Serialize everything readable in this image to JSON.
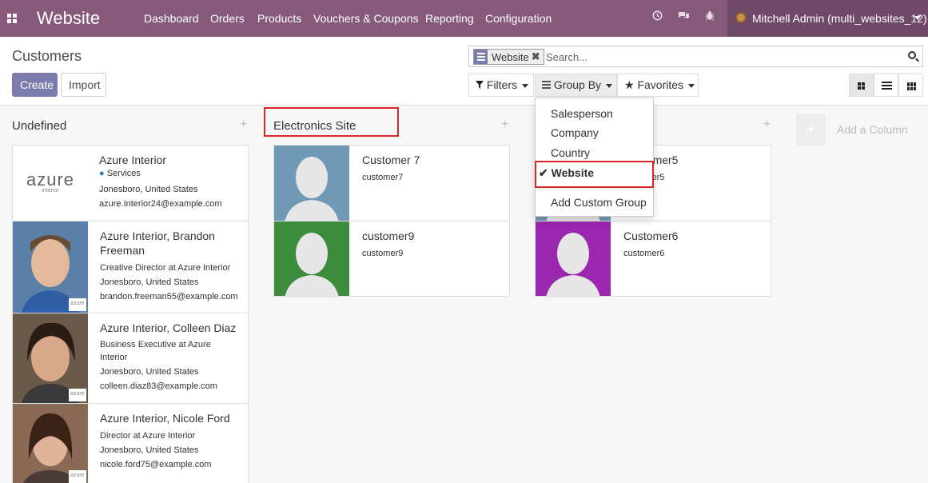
{
  "topbar": {
    "brand": "Website",
    "menu": [
      "Dashboard",
      "Orders",
      "Products",
      "Vouchers & Coupons",
      "Reporting",
      "Configuration"
    ],
    "icons": [
      "clock-icon",
      "chat-icon",
      "bug-icon"
    ],
    "user": "Mitchell Admin (multi_websites_12)",
    "bg": "#875a7b"
  },
  "page": {
    "title": "Customers",
    "create_label": "Create",
    "import_label": "Import"
  },
  "search": {
    "facet_label": "Website",
    "placeholder": "Search..."
  },
  "filters": {
    "filters_label": "Filters",
    "groupby_label": "Group By",
    "favorites_label": "Favorites"
  },
  "groupby_menu": {
    "items": [
      "Salesperson",
      "Company",
      "Country"
    ],
    "selected": "Website",
    "custom": "Add Custom Group"
  },
  "columns": [
    {
      "title": "Undefined",
      "cards": [
        {
          "name": "Azure Interior",
          "tag": "Services",
          "line1": "Jonesboro, United States",
          "line2": "azure.Interior24@example.com",
          "logo_text": "azure",
          "logo_sub": "interior"
        },
        {
          "name": "Azure Interior, Brandon Freeman",
          "line1": "Creative Director at Azure Interior",
          "line2": "Jonesboro, United States",
          "line3": "brandon.freeman55@example.com"
        },
        {
          "name": "Azure Interior, Colleen Diaz",
          "line1": "Business Executive at Azure Interior",
          "line2": "Jonesboro, United States",
          "line3": "colleen.diaz83@example.com"
        },
        {
          "name": "Azure Interior, Nicole Ford",
          "line1": "Director at Azure Interior",
          "line2": "Jonesboro, United States",
          "line3": "nicole.ford75@example.com"
        }
      ]
    },
    {
      "title": "Electronics Site",
      "cards": [
        {
          "name": "Customer 7",
          "line1": "customer7",
          "color": "#6f99b5"
        },
        {
          "name": "customer9",
          "line1": "customer9",
          "color": "#3d8b3d"
        }
      ]
    },
    {
      "title": "",
      "cards": [
        {
          "name": "Customer5",
          "line1": "customer5",
          "color": "#6f99b5"
        },
        {
          "name": "Customer6",
          "line1": "customer6",
          "color": "#9b27af"
        }
      ]
    }
  ],
  "add_column": "Add a Column",
  "mini_logo": "azure"
}
